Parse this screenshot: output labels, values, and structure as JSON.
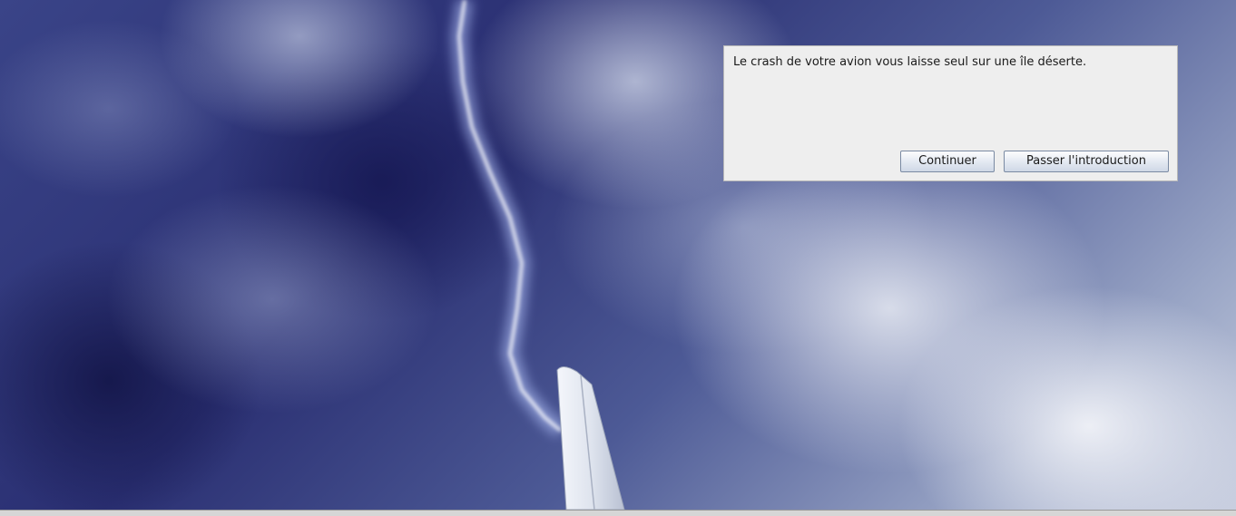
{
  "dialog": {
    "message": "Le crash de votre avion vous laisse seul sur une île déserte.",
    "continue_label": "Continuer",
    "skip_label": "Passer l'introduction"
  },
  "background": {
    "scene": "stormy-sky-lightning-plane-wing"
  }
}
